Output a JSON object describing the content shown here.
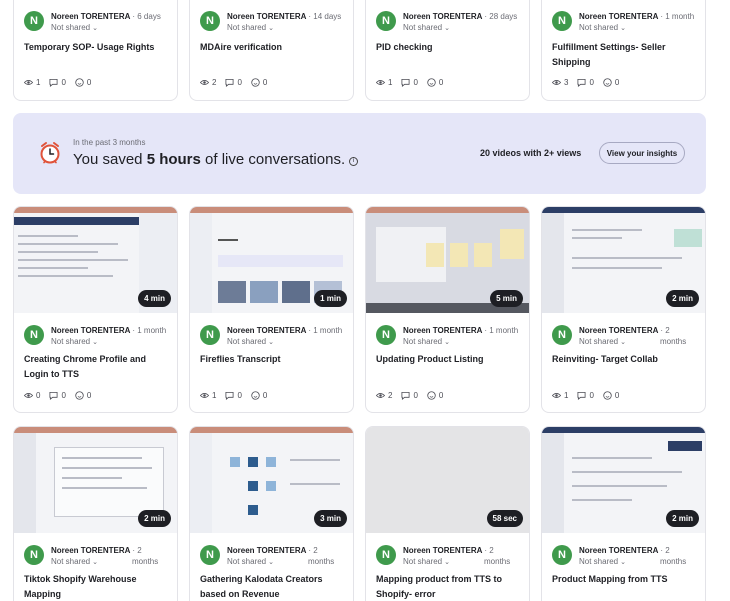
{
  "banner": {
    "period": "In the past 3 months",
    "saved_prefix": "You saved ",
    "saved_hours": "5 hours",
    "saved_suffix": " of live conversations.",
    "info": "i",
    "videos": "20 videos with 2+ views",
    "button": "View your insights"
  },
  "cards": [
    {
      "initial": "N",
      "author": "Noreen TORENTERA",
      "time": "· 6 days",
      "share": "Not shared",
      "title": "Temporary SOP- Usage Rights",
      "views": "1",
      "comments": "0",
      "reactions": "0"
    },
    {
      "initial": "N",
      "author": "Noreen TORENTERA",
      "time": "· 14 days",
      "share": "Not shared",
      "title": "MDAire verification",
      "views": "2",
      "comments": "0",
      "reactions": "0"
    },
    {
      "initial": "N",
      "author": "Noreen TORENTERA",
      "time": "· 28 days",
      "share": "Not shared",
      "title": "PID checking",
      "views": "1",
      "comments": "0",
      "reactions": "0"
    },
    {
      "initial": "N",
      "author": "Noreen TORENTERA",
      "time": "· 1 month",
      "share": "Not shared",
      "title": "Fulfillment Settings- Seller Shipping",
      "views": "3",
      "comments": "0",
      "reactions": "0"
    },
    {
      "initial": "N",
      "author": "Noreen TORENTERA",
      "time": "· 1 month",
      "share": "Not shared",
      "title": "Creating Chrome Profile and Login to TTS",
      "views": "0",
      "comments": "0",
      "reactions": "0",
      "duration": "4 min"
    },
    {
      "initial": "N",
      "author": "Noreen TORENTERA",
      "time": "· 1 month",
      "share": "Not shared",
      "title": "Fireflies Transcript",
      "views": "1",
      "comments": "0",
      "reactions": "0",
      "duration": "1 min"
    },
    {
      "initial": "N",
      "author": "Noreen TORENTERA",
      "time": "· 1 month",
      "share": "Not shared",
      "title": "Updating Product Listing",
      "views": "2",
      "comments": "0",
      "reactions": "0",
      "duration": "5 min"
    },
    {
      "initial": "N",
      "author": "Noreen TORENTERA",
      "time": "· 2",
      "time2": "months",
      "share": "Not shared",
      "title": "Reinviting- Target Collab",
      "views": "1",
      "comments": "0",
      "reactions": "0",
      "duration": "2 min"
    },
    {
      "initial": "N",
      "author": "Noreen TORENTERA",
      "time": "· 2",
      "time2": "months",
      "share": "Not shared",
      "title": "Tiktok Shopify Warehouse Mapping",
      "duration": "2 min"
    },
    {
      "initial": "N",
      "author": "Noreen TORENTERA",
      "time": "· 2",
      "time2": "months",
      "share": "Not shared",
      "title": "Gathering Kalodata Creators based on Revenue",
      "duration": "3 min"
    },
    {
      "initial": "N",
      "author": "Noreen TORENTERA",
      "time": "· 2",
      "time2": "months",
      "share": "Not shared",
      "title": "Mapping product from TTS to Shopify- error",
      "duration": "58 sec"
    },
    {
      "initial": "N",
      "author": "Noreen TORENTERA",
      "time": "· 2",
      "time2": "months",
      "share": "Not shared",
      "title": "Product Mapping from TTS",
      "duration": "2 min"
    }
  ]
}
